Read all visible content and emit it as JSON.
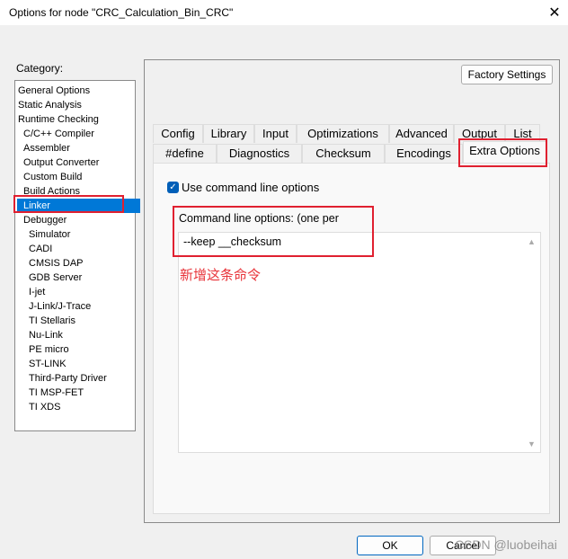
{
  "window": {
    "title": "Options for node \"CRC_Calculation_Bin_CRC\"",
    "close_icon": "close-icon"
  },
  "category": {
    "label": "Category:",
    "items": [
      "General Options",
      "Static Analysis",
      "Runtime Checking",
      "C/C++ Compiler",
      "Assembler",
      "Output Converter",
      "Custom Build",
      "Build Actions",
      "Linker",
      "Debugger",
      "Simulator",
      "CADI",
      "CMSIS DAP",
      "GDB Server",
      "I-jet",
      "J-Link/J-Trace",
      "TI Stellaris",
      "Nu-Link",
      "PE micro",
      "ST-LINK",
      "Third-Party Driver",
      "TI MSP-FET",
      "TI XDS"
    ],
    "selected": "Linker"
  },
  "factory_settings": "Factory Settings",
  "tabs": {
    "row1": [
      "Config",
      "Library",
      "Input",
      "Optimizations",
      "Advanced",
      "Output",
      "List"
    ],
    "row2": [
      "#define",
      "Diagnostics",
      "Checksum",
      "Encodings",
      "Extra Options"
    ],
    "active": "Extra Options"
  },
  "extra": {
    "use_cmd_label": "Use command line options",
    "use_cmd_checked": true,
    "cmd_label": "Command line options:  (one per",
    "cmd_value": "--keep __checksum",
    "annotation": "新增这条命令"
  },
  "buttons": {
    "ok": "OK",
    "cancel": "Cancel"
  },
  "watermark": "CSDN @luobeihai",
  "colors": {
    "highlight": "#e02030",
    "selection": "#0078d7"
  }
}
